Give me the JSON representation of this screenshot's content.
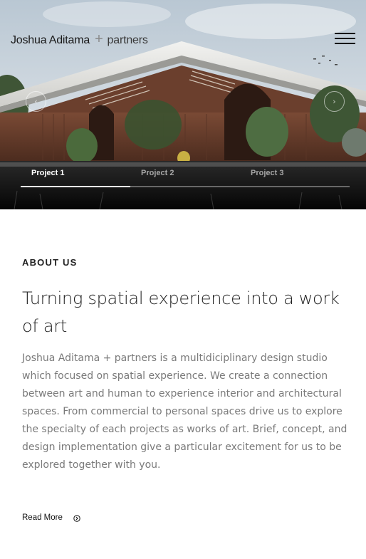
{
  "header": {
    "logo_name": "Joshua Aditama",
    "logo_plus": "+",
    "logo_partners": "partners",
    "menu_icon": "hamburger-menu-icon"
  },
  "slider": {
    "prev_icon": "chevron-left-icon",
    "next_icon": "chevron-right-icon",
    "tabs": [
      {
        "label": "Project 1",
        "active": true
      },
      {
        "label": "Project 2",
        "active": false
      },
      {
        "label": "Project 3",
        "active": false
      }
    ],
    "progress": 0.333
  },
  "about": {
    "heading": "ABOUT US",
    "title": "Turning spatial experience into a work of art",
    "body": "Joshua Aditama + partners is a multidiciplinary design studio which focused on spatial experience. We create a connection between art and human to experience interior and architectural spaces. From commercial to personal spaces drive us to explore the specialty of each projects as works of art. Brief, concept, and design implementation give a particular excitement for us to be explored together with you.",
    "read_more": "Read More",
    "read_more_icon": "arrow-circle-right-icon"
  },
  "colors": {
    "text_dark": "#222222",
    "text_body": "#7a7a7a",
    "accent": "#ffffff"
  }
}
